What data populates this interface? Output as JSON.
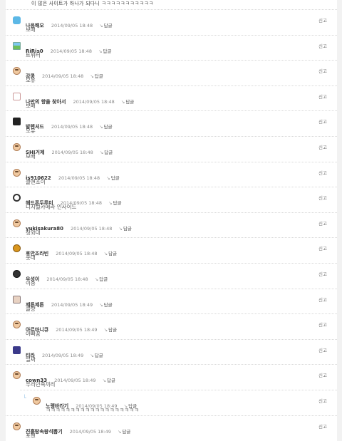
{
  "top_text": "이 많은 사이트가 하나가 되다니 ㅋㅋㅋㅋㅋㅋㅋㅋㅋㅋㅋ",
  "reply_label": "답글",
  "report_label": "신고",
  "comments": [
    {
      "name": "나응해오",
      "date": "2014/09/05 18:48",
      "body": "보배",
      "avatar": "blue-character-icon"
    },
    {
      "name": "RiRis0",
      "date": "2014/09/05 18:48",
      "body": "트위터",
      "avatar": "landscape-icon"
    },
    {
      "name": "강콩",
      "date": "2014/09/05 18:48",
      "body": "오유",
      "avatar": "face-icon"
    },
    {
      "name": "나만의 향을 찾아서",
      "date": "2014/09/05 18:48",
      "body": "보배",
      "avatar": "cat-icon"
    },
    {
      "name": "발렌셔드",
      "date": "2014/09/05 18:48",
      "body": "오유",
      "avatar": "black-character-icon"
    },
    {
      "name": "SHI거제",
      "date": "2014/09/05 18:48",
      "body": "보배",
      "avatar": "face-icon"
    },
    {
      "name": "is910622",
      "date": "2014/09/05 18:48",
      "body": "클앤조이",
      "avatar": "face-icon"
    },
    {
      "name": "헤드폰두루미",
      "date": "2014/09/05 18:48",
      "body": "디지털카메라 인사이드",
      "avatar": "headphones-icon"
    },
    {
      "name": "yukisakura80",
      "date": "2014/09/05 18:48",
      "body": "청와대",
      "avatar": "face-icon"
    },
    {
      "name": "후안조라빈",
      "date": "2014/09/05 18:48",
      "body": "웃대",
      "avatar": "lion-icon"
    },
    {
      "name": "우성이",
      "date": "2014/09/05 18:48",
      "body": "이종",
      "avatar": "monster-icon"
    },
    {
      "name": "제튼제튼",
      "date": "2014/09/05 18:49",
      "body": "클량",
      "avatar": "small-character-icon"
    },
    {
      "name": "아르마니큐",
      "date": "2014/09/05 18:49",
      "body": "아빠꿈",
      "avatar": "face-icon"
    },
    {
      "name": "티라",
      "date": "2014/09/05 18:49",
      "body": "일짜",
      "avatar": "dark-character-icon"
    },
    {
      "name": "cown33",
      "date": "2014/09/05 18:49",
      "body": "우리민족끼리",
      "avatar": "face-icon"
    },
    {
      "name": "노랭바라기",
      "date": "2014/09/05 18:49",
      "body": "ㅋㅋㅋㅋㅋㅋㅋㅋㅋㅋㅋㅋㅋㅋㅋㅋㅋㅋㅋ",
      "avatar": "face-icon",
      "reply": true
    },
    {
      "name": "진흙탕속왕석뽑기",
      "date": "2014/09/05 18:49",
      "body": "포챈",
      "avatar": "face-icon"
    }
  ]
}
